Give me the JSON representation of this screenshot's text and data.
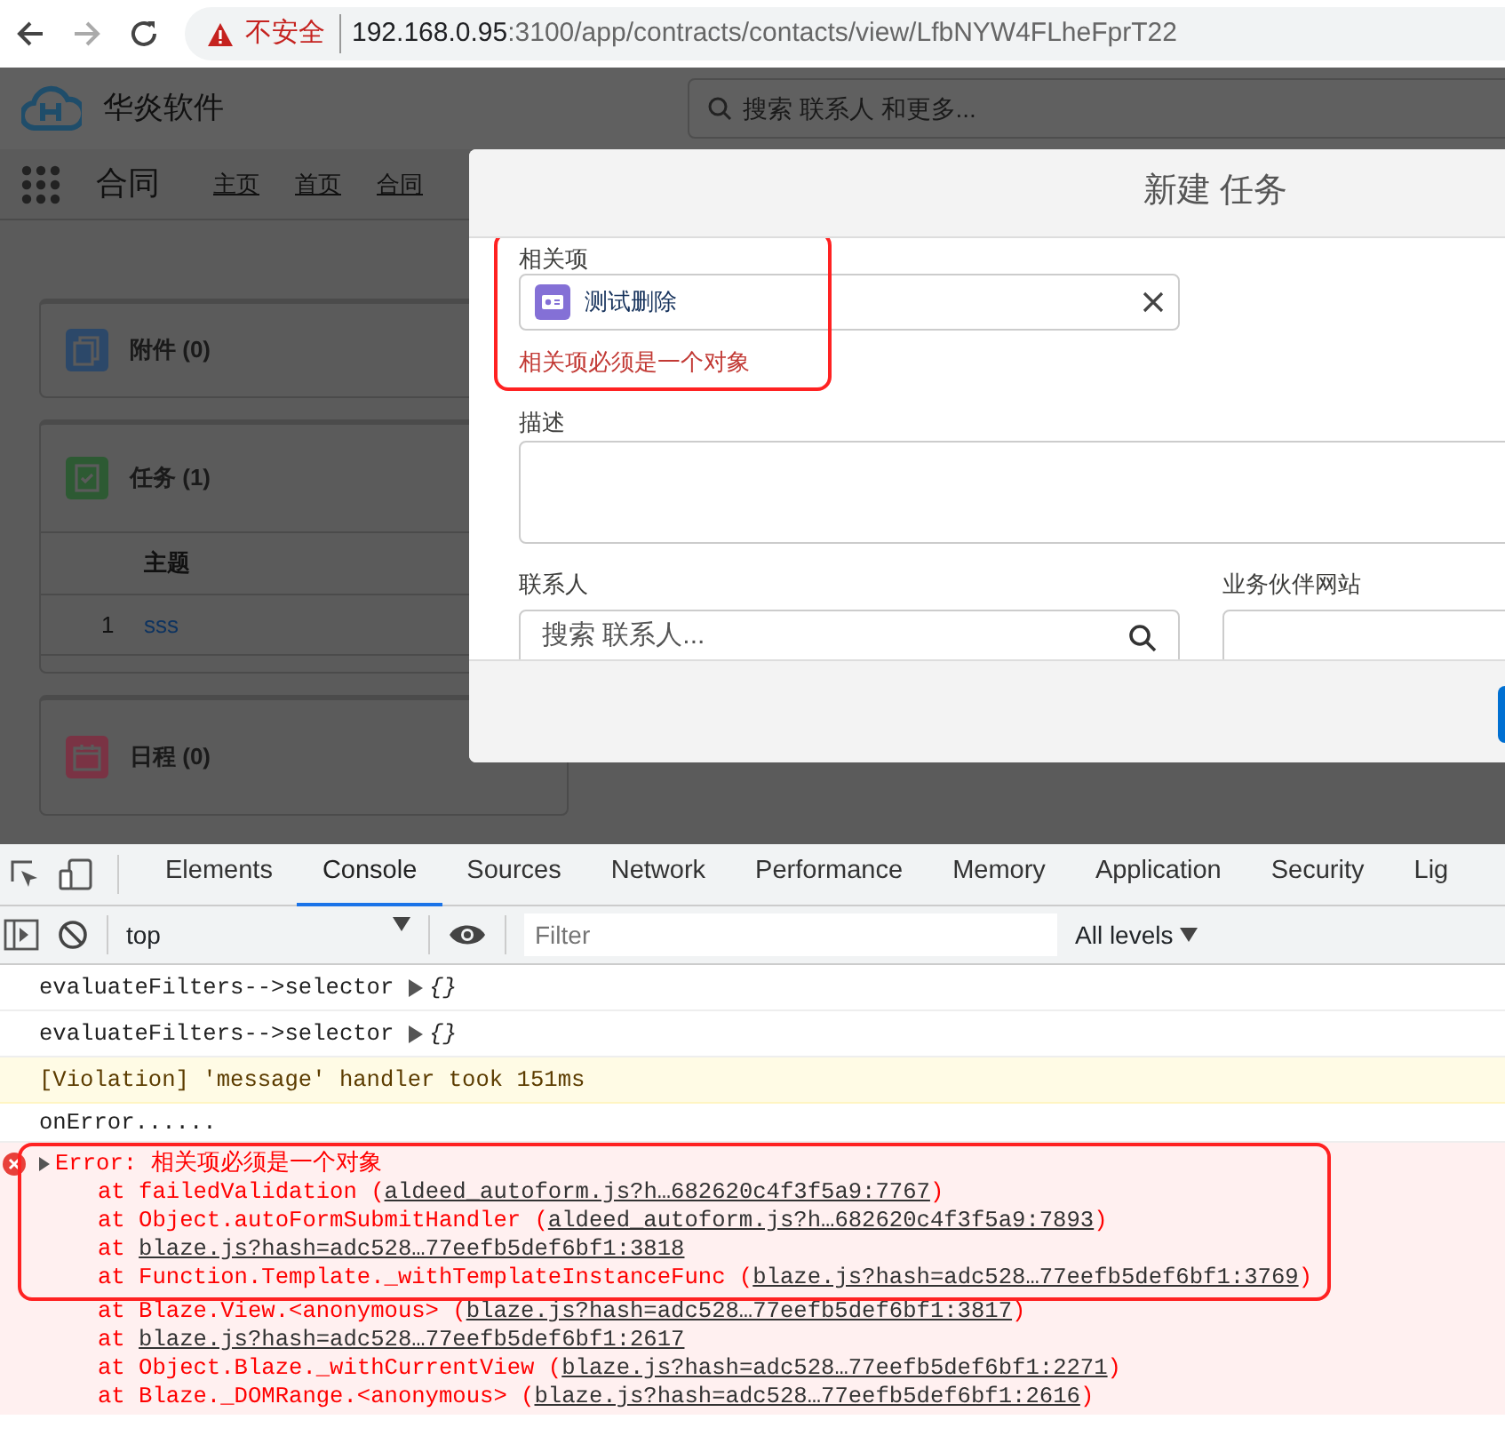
{
  "browser": {
    "security_label": "不安全",
    "url_host": "192.168.0.95",
    "url_rest": ":3100/app/contracts/contacts/view/LfbNYW4FLheFprT22"
  },
  "app": {
    "brand": "华炎软件",
    "search_placeholder": "搜索 联系人 和更多...",
    "module": "合同",
    "nav": [
      {
        "label": "主页",
        "selected": false
      },
      {
        "label": "首页",
        "selected": false
      },
      {
        "label": "合同",
        "selected": false
      }
    ],
    "cards": [
      {
        "kind": "attachments",
        "title": "附件 (0)"
      },
      {
        "kind": "tasks",
        "title": "任务 (1)",
        "column": "主题",
        "rows": [
          {
            "index": "1",
            "subject": "sss"
          }
        ]
      },
      {
        "kind": "events",
        "title": "日程 (0)"
      }
    ]
  },
  "modal": {
    "title": "新建 任务",
    "related": {
      "label": "相关项",
      "value": "测试删除",
      "error": "相关项必须是一个对象",
      "highlighted": true
    },
    "description": {
      "label": "描述"
    },
    "contact": {
      "label": "联系人",
      "placeholder": "搜索 联系人..."
    },
    "website": {
      "label": "业务伙伴网站"
    }
  },
  "devtools": {
    "tabs": [
      {
        "label": "Elements",
        "selected": false
      },
      {
        "label": "Console",
        "selected": true
      },
      {
        "label": "Sources",
        "selected": false
      },
      {
        "label": "Network",
        "selected": false
      },
      {
        "label": "Performance",
        "selected": false
      },
      {
        "label": "Memory",
        "selected": false
      },
      {
        "label": "Application",
        "selected": false
      },
      {
        "label": "Security",
        "selected": false
      },
      {
        "label": "Lig",
        "selected": false
      }
    ],
    "context": "top",
    "filter_placeholder": "Filter",
    "levels": "All levels",
    "messages": [
      {
        "kind": "log",
        "text": "evaluateFilters-->selector",
        "object": "{}"
      },
      {
        "kind": "log",
        "text": "evaluateFilters-->selector",
        "object": "{}"
      },
      {
        "kind": "violation",
        "text": "[Violation] 'message' handler took 151ms"
      },
      {
        "kind": "plain",
        "text": "onError......"
      },
      {
        "kind": "error",
        "text": "Error: 相关项必须是一个对象",
        "highlighted": true,
        "frames": [
          {
            "text": "at failedValidation (",
            "link": "aldeed_autoform.js?h…682620c4f3f5a9:7767",
            "suffix": ")",
            "highlighted": true
          },
          {
            "text": "at Object.autoFormSubmitHandler (",
            "link": "aldeed_autoform.js?h…682620c4f3f5a9:7893",
            "suffix": ")",
            "highlighted": true
          },
          {
            "text": "at ",
            "link": "blaze.js?hash=adc528…77eefb5def6bf1:3818",
            "highlighted": true
          },
          {
            "text": "at Function.Template._withTemplateInstanceFunc (",
            "link": "blaze.js?hash=adc528…77eefb5def6bf1:3769",
            "suffix": ")",
            "highlighted": true
          },
          {
            "text": "at Blaze.View.<anonymous> (",
            "link": "blaze.js?hash=adc528…77eefb5def6bf1:3817",
            "suffix": ")",
            "highlighted": false
          },
          {
            "text": "at ",
            "link": "blaze.js?hash=adc528…77eefb5def6bf1:2617",
            "highlighted": false
          },
          {
            "text": "at Object.Blaze._withCurrentView (",
            "link": "blaze.js?hash=adc528…77eefb5def6bf1:2271",
            "suffix": ")",
            "highlighted": false
          },
          {
            "text": "at Blaze._DOMRange.<anonymous> (",
            "link": "blaze.js?hash=adc528…77eefb5def6bf1:2616",
            "suffix": ")",
            "highlighted": false
          }
        ]
      }
    ]
  }
}
